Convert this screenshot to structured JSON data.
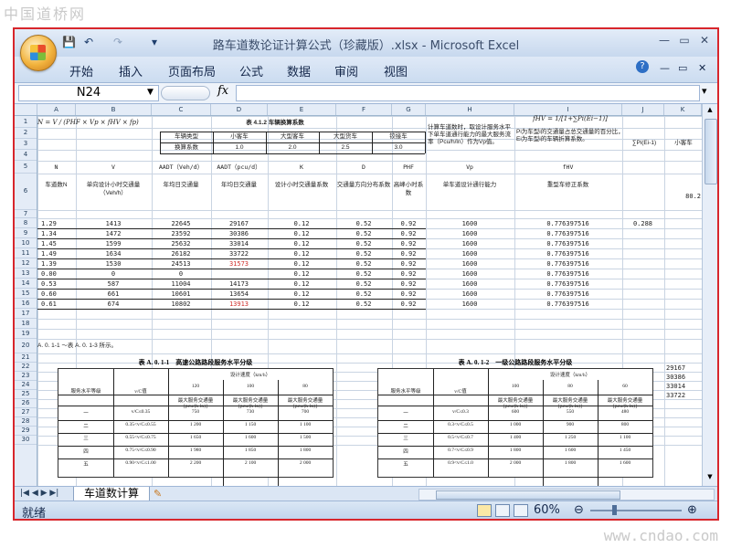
{
  "watermark_top": "中国道桥网",
  "watermark_bottom": "www.cndao.com",
  "window": {
    "title": "路车道数论证计算公式（珍藏版）.xlsx - Microsoft Excel",
    "min": "—",
    "restore": "▭",
    "close": "✕"
  },
  "quick_access": {
    "save": "💾",
    "undo": "↶",
    "redo": "↷",
    "customize": "▾"
  },
  "ribbon_tabs": [
    "开始",
    "插入",
    "页面布局",
    "公式",
    "数据",
    "审阅",
    "视图"
  ],
  "name_box": "N24",
  "formula_fx": "fx",
  "columns": [
    "A",
    "B",
    "C",
    "D",
    "E",
    "F",
    "G",
    "H",
    "I",
    "J",
    "K"
  ],
  "rows": [
    "1",
    "2",
    "3",
    "4",
    "5",
    "6",
    "7",
    "8",
    "9",
    "10",
    "11",
    "12",
    "13",
    "14",
    "15",
    "16",
    "17",
    "18",
    "19",
    "20",
    "21",
    "22",
    "23",
    "24",
    "25",
    "26",
    "27",
    "28",
    "29",
    "30"
  ],
  "sheet": {
    "formula_top": "N = V / (PHF × Vp × fHV × fp)",
    "table_title": "表 4.1.2 车辆换算系数",
    "conv_headers": [
      "车辆类型",
      "小客车",
      "大型客车",
      "大型货车",
      "铰接车"
    ],
    "conv_row_label": "换算系数",
    "conv_values": [
      "1.0",
      "2.0",
      "2.5",
      "3.0"
    ],
    "note_h": "计算车道数时，取设计服务水平下单车道通行能力的最大服务流率（Pcu/h/ln）作为Vp值。",
    "formula_i": "fHV = 1/[1+∑Pi(Ei−1)]",
    "note_i": "Pi为车型i的交通量占总交通量的百分比，Ei为车型i的车辆折算系数。",
    "j_header": "∑Pi(Ei-1)",
    "k_header": "小客车",
    "symbols": [
      "N",
      "V",
      "AADT（Veh/d）",
      "AADT（pcu/d）",
      "K",
      "D",
      "PHF",
      "Vp",
      "fHV"
    ],
    "descriptions": [
      "车道数N",
      "单向设计小时交通量（Veh/h）",
      "年均日交通量",
      "年均日交通量",
      "设计小时交通量系数",
      "交通量方向分布系数",
      "高峰小时系数",
      "单车道设计通行能力",
      "重型车修正系数"
    ],
    "k6": "80.2",
    "data_rows": [
      [
        "1.29",
        "1413",
        "22645",
        "29167",
        "0.12",
        "0.52",
        "0.92",
        "1600",
        "0.776397516"
      ],
      [
        "1.34",
        "1472",
        "23592",
        "30386",
        "0.12",
        "0.52",
        "0.92",
        "1600",
        "0.776397516"
      ],
      [
        "1.45",
        "1599",
        "25632",
        "33014",
        "0.12",
        "0.52",
        "0.92",
        "1600",
        "0.776397516"
      ],
      [
        "1.49",
        "1634",
        "26182",
        "33722",
        "0.12",
        "0.52",
        "0.92",
        "1600",
        "0.776397516"
      ],
      [
        "1.39",
        "1530",
        "24513",
        "31573",
        "0.12",
        "0.52",
        "0.92",
        "1600",
        "0.776397516"
      ],
      [
        "0.00",
        "0",
        "0",
        "",
        "0.12",
        "0.52",
        "0.92",
        "1600",
        "0.776397516"
      ],
      [
        "0.53",
        "587",
        "11004",
        "14173",
        "0.12",
        "0.52",
        "0.92",
        "1600",
        "0.776397516"
      ],
      [
        "0.60",
        "661",
        "10601",
        "13654",
        "0.12",
        "0.52",
        "0.92",
        "1600",
        "0.776397516"
      ],
      [
        "0.61",
        "674",
        "10802",
        "13913",
        "0.12",
        "0.52",
        "0.92",
        "1600",
        "0.776397516"
      ]
    ],
    "red_cells": [
      [
        "12",
        "D"
      ],
      [
        "16",
        "D"
      ]
    ],
    "j8": "0.288",
    "note_row20": "A. 0. 1-1 ～表 A. 0. 1-3 所示。",
    "k_side_values": [
      "29167",
      "30386",
      "33014",
      "33722"
    ],
    "table_a1": {
      "title": "表 A. 0. 1-1　高速公路路段服务水平分级",
      "col1": "服务水平等级",
      "col2": "v/C值",
      "speed_header": "设计速度（km/h）",
      "speeds": [
        "120",
        "100",
        "80"
      ],
      "sub": "最大服务交通量 [pcu/(h·ln)]",
      "rows": [
        [
          "一",
          "v/C≤0.35",
          "750",
          "730",
          "700"
        ],
        [
          "二",
          "0.35<v/C≤0.55",
          "1 200",
          "1 150",
          "1 100"
        ],
        [
          "三",
          "0.55<v/C≤0.75",
          "1 650",
          "1 600",
          "1 500"
        ],
        [
          "四",
          "0.75<v/C≤0.90",
          "1 980",
          "1 850",
          "1 800"
        ],
        [
          "五",
          "0.90<v/C≤1.00",
          "2 200",
          "2 100",
          "2 000"
        ]
      ]
    },
    "table_a2": {
      "title": "表 A. 0. 1-2　一级公路路段服务水平分级",
      "col1": "服务水平等级",
      "col2": "v/C值",
      "speed_header": "设计速度（km/h）",
      "speeds": [
        "100",
        "80",
        "60"
      ],
      "sub": "最大服务交通量 [pcu/(h·ln)]",
      "rows": [
        [
          "一",
          "v/C≤0.3",
          "600",
          "550",
          "480"
        ],
        [
          "二",
          "0.3<v/C≤0.5",
          "1 000",
          "900",
          "800"
        ],
        [
          "三",
          "0.5<v/C≤0.7",
          "1 400",
          "1 250",
          "1 100"
        ],
        [
          "四",
          "0.7<v/C≤0.9",
          "1 800",
          "1 600",
          "1 450"
        ],
        [
          "五",
          "0.9<v/C≤1.0",
          "2 000",
          "1 800",
          "1 600"
        ]
      ]
    }
  },
  "sheet_tab": "车道数计算",
  "status": "就绪",
  "zoom": "60%"
}
